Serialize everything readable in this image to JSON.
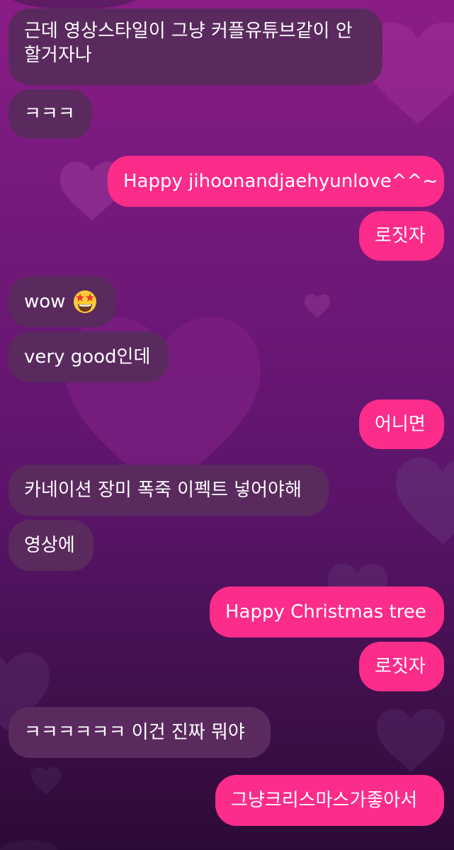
{
  "messages": [
    {
      "id": "m1",
      "side": "in",
      "text": "근데 영상스타일이 그냥 커플유튜브같이 안 할거자나"
    },
    {
      "id": "m2",
      "side": "in",
      "text": "ㅋㅋㅋ"
    },
    {
      "id": "m3",
      "side": "out",
      "text": "Happy jihoonandjaehyunlove^^~"
    },
    {
      "id": "m4",
      "side": "out",
      "text": "로짓자"
    },
    {
      "id": "m5",
      "side": "in",
      "text": "wow",
      "emoji": "star-struck-emoji-icon"
    },
    {
      "id": "m6",
      "side": "in",
      "text": "very good인데"
    },
    {
      "id": "m7",
      "side": "out",
      "text": "어니면"
    },
    {
      "id": "m8",
      "side": "in",
      "text": "카네이션 장미 폭죽 이펙트 넣어야해"
    },
    {
      "id": "m9",
      "side": "in",
      "text": "영상에"
    },
    {
      "id": "m10",
      "side": "out",
      "text": "Happy Christmas tree"
    },
    {
      "id": "m11",
      "side": "out",
      "text": "로짓자"
    },
    {
      "id": "m12",
      "side": "in",
      "text": "ㅋㅋㅋㅋㅋㅋ 이건 진짜 뭐야"
    },
    {
      "id": "m13",
      "side": "out",
      "text": "그냥크리스마스가좋아서"
    }
  ],
  "colors": {
    "incoming_bubble": "#5a2a5e",
    "outgoing_bubble": "#fb2c8a",
    "background_top": "#8b1c86",
    "background_bottom": "#2c0a36",
    "text": "#ffffff"
  },
  "background_icon": "heart-pattern"
}
